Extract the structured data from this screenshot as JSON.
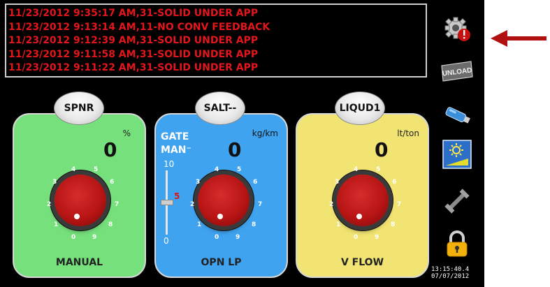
{
  "alarm_log": [
    "11/23/2012 9:35:17 AM,31-SOLID UNDER APP",
    "11/23/2012 9:13:14 AM,11-NO CONV FEEDBACK",
    "11/23/2012 9:12:39 AM,31-SOLID UNDER APP",
    "11/23/2012 9:11:58 AM,31-SOLID UNDER APP",
    "11/23/2012 9:11:22 AM,31-SOLID UNDER APP"
  ],
  "sidebar": {
    "settings_icon": "gear-alert-icon",
    "unload_label": "UNLOAD",
    "usb_icon": "usb-drive-icon",
    "brightness_icon": "brightness-icon",
    "tool_icon": "wrench-icon",
    "lock_icon": "padlock-icon"
  },
  "panels": {
    "spinner": {
      "tab": "SPNR",
      "unit": "%",
      "value": "0",
      "mode": "MANUAL",
      "color": "#76e07c"
    },
    "salt": {
      "tab": "SALT--",
      "unit": "kg/km",
      "value": "0",
      "mode": "OPN LP",
      "gate_label": "GATE",
      "man_label": "MAN⁻",
      "gate_max": "10",
      "gate_min": "0",
      "gate_value": "5",
      "color": "#3fa3f0"
    },
    "liquid": {
      "tab": "LIQUD1",
      "unit": "lt/ton",
      "value": "0",
      "mode": "V FLOW",
      "color": "#f1e472"
    }
  },
  "knob_scale": [
    "0",
    "1",
    "2",
    "3",
    "4",
    "5",
    "6",
    "7",
    "8",
    "9"
  ],
  "clock": {
    "time": "13:15:40.4",
    "date": "07/07/2012"
  },
  "accent": {
    "alarm_red": "#e3161b",
    "arrow_red": "#b01010"
  }
}
